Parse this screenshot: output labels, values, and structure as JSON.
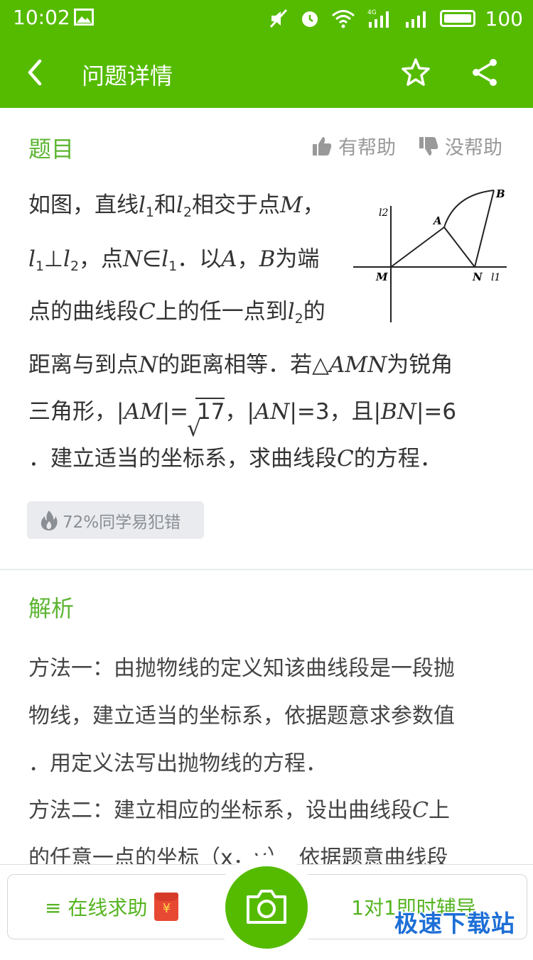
{
  "status_bar": {
    "time": "10:02",
    "battery": "100",
    "network": "4G"
  },
  "nav": {
    "title": "问题详情"
  },
  "question": {
    "section_label": "题目",
    "helpful_label": "有帮助",
    "unhelpful_label": "没帮助",
    "figure_labels": {
      "l2": "l2",
      "A": "A",
      "B": "B",
      "M": "M",
      "N": "N",
      "l1": "l1"
    },
    "mistake_badge": "72%同学易犯错"
  },
  "analysis": {
    "section_label": "解析",
    "line1": "方法一：由抛物线的定义知该曲线段是一段抛",
    "line2": "物线，建立适当的坐标系，依据题意求参数值",
    "line3": "．用定义法写出抛物线的方程．",
    "line4_prefix": "方法二：建立相应的坐标系，设出曲线段",
    "line4_var": "C",
    "line4_suffix": "上",
    "line5": "的任意一点的坐标（x，y），依据题意曲线段"
  },
  "bottom_bar": {
    "help_label": "≡ 在线求助",
    "tutor_label": "1对1即时辅导",
    "watermark": "极速下载站",
    "hongbao_symbol": "¥"
  }
}
